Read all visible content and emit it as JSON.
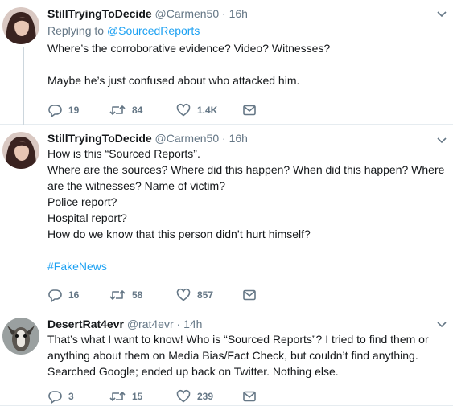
{
  "tweets": [
    {
      "name": "StillTryingToDecide",
      "handle": "@Carmen50",
      "separator": "·",
      "time": "16h",
      "replying_prefix": "Replying to",
      "replying_to": "@SourcedReports",
      "lines": [
        "Where’s the corroborative evidence? Video? Witnesses?",
        "",
        "Maybe he’s just confused about who attacked him."
      ],
      "replies": "19",
      "retweets": "84",
      "likes": "1.4K"
    },
    {
      "name": "StillTryingToDecide",
      "handle": "@Carmen50",
      "separator": "·",
      "time": "16h",
      "lines": [
        "How is this “Sourced Reports”.",
        "Where are the sources? Where did this happen? When did this happen? Where",
        "are the witnesses? Name of victim?",
        "Police report?",
        "Hospital report?",
        "How do we know that this person didn’t hurt himself?",
        ""
      ],
      "hashtag": "#FakeNews",
      "replies": "16",
      "retweets": "58",
      "likes": "857"
    },
    {
      "name": "DesertRat4evr",
      "handle": "@rat4evr",
      "separator": "·",
      "time": "14h",
      "lines": [
        "That’s what I want to know! Who is “Sourced Reports”? I tried to find them or",
        "anything about them on Media Bias/Fact Check, but couldn’t find anything.",
        "Searched Google; ended up back on Twitter. Nothing else."
      ],
      "replies": "3",
      "retweets": "15",
      "likes": "239"
    }
  ],
  "colors": {
    "link": "#1da1f2",
    "muted": "#657786",
    "text": "#14171a",
    "divider": "#e6ecf0"
  },
  "icons": {
    "reply": "reply-icon",
    "retweet": "retweet-icon",
    "like": "heart-icon",
    "message": "envelope-icon",
    "menu": "chevron-down-icon"
  }
}
